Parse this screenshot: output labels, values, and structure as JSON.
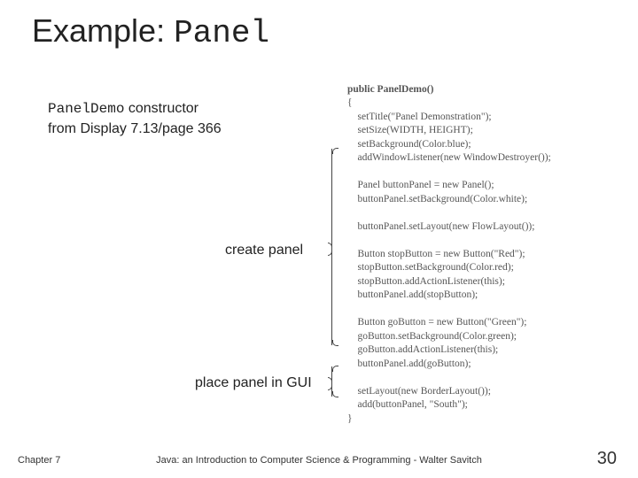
{
  "title": {
    "prefix": "Example: ",
    "code": "Panel"
  },
  "desc": {
    "code": "PanelDemo",
    "rest": " constructor",
    "line2": "from Display 7.13/page 366"
  },
  "labels": {
    "create": "create panel",
    "place": "place panel in GUI"
  },
  "code": {
    "sig": "public PanelDemo()",
    "open": "{",
    "l1": "    setTitle(\"Panel Demonstration\");",
    "l2": "    setSize(WIDTH, HEIGHT);",
    "l3": "    setBackground(Color.blue);",
    "l4": "    addWindowListener(new WindowDestroyer());",
    "l5": "    Panel buttonPanel = new Panel();",
    "l6": "    buttonPanel.setBackground(Color.white);",
    "l7": "    buttonPanel.setLayout(new FlowLayout());",
    "l8": "    Button stopButton = new Button(\"Red\");",
    "l9": "    stopButton.setBackground(Color.red);",
    "l10": "    stopButton.addActionListener(this);",
    "l11": "    buttonPanel.add(stopButton);",
    "l12": "    Button goButton = new Button(\"Green\");",
    "l13": "    goButton.setBackground(Color.green);",
    "l14": "    goButton.addActionListener(this);",
    "l15": "    buttonPanel.add(goButton);",
    "l16": "    setLayout(new BorderLayout());",
    "l17": "    add(buttonPanel, \"South\");",
    "close": "}"
  },
  "footer": {
    "left": "Chapter 7",
    "center": "Java: an Introduction to Computer Science & Programming - Walter Savitch",
    "right": "30"
  }
}
